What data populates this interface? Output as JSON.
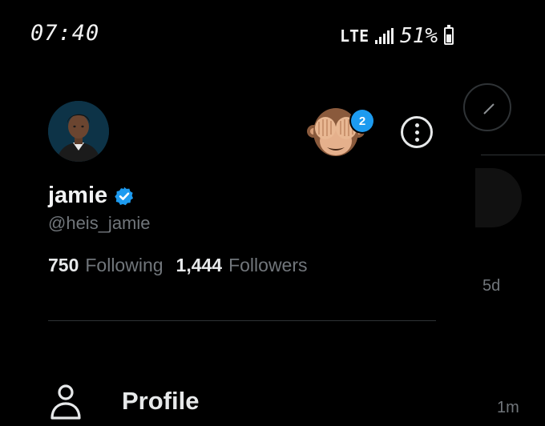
{
  "status_bar": {
    "time": "07:40",
    "network": "LTE",
    "battery_percent": "51%",
    "battery_level": 0.51
  },
  "header": {
    "notification_badge": "2"
  },
  "user": {
    "name": "jamie",
    "handle": "@heis_jamie",
    "following_count": "750",
    "following_label": "Following",
    "followers_count": "1,444",
    "followers_label": "Followers",
    "verified": true
  },
  "menu": {
    "profile_label": "Profile"
  },
  "background_timeline": {
    "time_a": "5d",
    "time_b": "1m"
  },
  "colors": {
    "accent": "#1d9bf0",
    "background": "#000000",
    "secondary_text": "#71767b"
  }
}
